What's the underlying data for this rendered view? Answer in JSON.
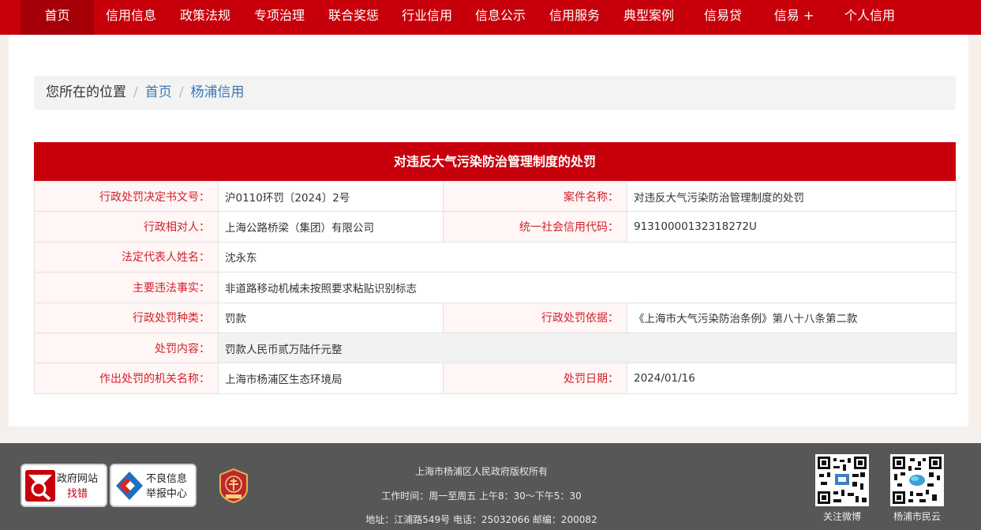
{
  "nav": {
    "items": [
      {
        "label": "首页",
        "active": true
      },
      {
        "label": "信用信息"
      },
      {
        "label": "政策法规"
      },
      {
        "label": "专项治理"
      },
      {
        "label": "联合奖惩"
      },
      {
        "label": "行业信用"
      },
      {
        "label": "信息公示"
      },
      {
        "label": "信用服务"
      },
      {
        "label": "典型案例"
      },
      {
        "label": "信易贷"
      },
      {
        "label": "信易 +"
      },
      {
        "label": "个人信用"
      }
    ]
  },
  "breadcrumb": {
    "label": "您所在的位置",
    "separator": "/",
    "home": "首页",
    "current": "杨浦信用"
  },
  "detail": {
    "title": "对违反大气污染防治管理制度的处罚",
    "rows": {
      "decision_no_label": "行政处罚决定书文号：",
      "decision_no": "沪0110环罚〔2024〕2号",
      "case_name_label": "案件名称：",
      "case_name": "对违反大气污染防治管理制度的处罚",
      "party_label": "行政相对人：",
      "party": "上海公路桥梁（集团）有限公司",
      "credit_code_label": "统一社会信用代码：",
      "credit_code": "91310000132318272U",
      "legal_rep_label": "法定代表人姓名：",
      "legal_rep": "沈永东",
      "facts_label": "主要违法事实：",
      "facts": "非道路移动机械未按照要求粘贴识别标志",
      "type_label": "行政处罚种类：",
      "type": "罚款",
      "basis_label": "行政处罚依据：",
      "basis": "《上海市大气污染防治条例》第八十八条第二款",
      "content_label": "处罚内容：",
      "content": "罚款人民币贰万陆仟元整",
      "authority_label": "作出处罚的机关名称：",
      "authority": "上海市杨浦区生态环境局",
      "date_label": "处罚日期：",
      "date": "2024/01/16"
    }
  },
  "footer": {
    "gov_site": {
      "line1": "政府网站",
      "line2": "找错"
    },
    "report": {
      "line1": "不良信息",
      "line2": "举报中心"
    },
    "copyright": "上海市杨浦区人民政府版权所有",
    "hours": "工作时间：周一至周五 上午8：30～下午5：30",
    "address": "地址：江浦路549号 电话：25032066 邮编：200082",
    "qr1_label": "关注微博",
    "qr2_label": "杨浦市民云"
  },
  "colors": {
    "brand_red": "#c7000b",
    "footer_gray": "#575757",
    "link_blue": "#3a77b8"
  }
}
